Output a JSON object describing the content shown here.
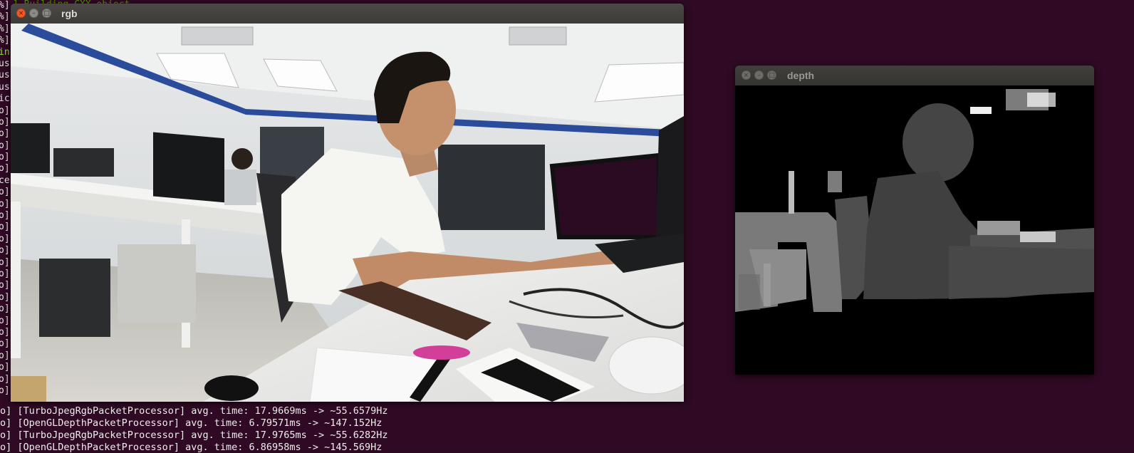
{
  "terminal": {
    "top_line": "] Building CXX object ...",
    "left_gutter": [
      "%]",
      "%]",
      "%]",
      "%]",
      "in",
      "us",
      "us",
      "us",
      "ic",
      "o]",
      "o]",
      "o]",
      "o]",
      "o]",
      "o]",
      "ce",
      "o]",
      "o]",
      "o]",
      "o]",
      "o]",
      "o]",
      "o]",
      "o]",
      "o]",
      "o]",
      "o]",
      "o]",
      "o]",
      "o]",
      "o]",
      "o]",
      "o]",
      "o]"
    ],
    "log_lines": [
      "o] [TurboJpegRgbPacketProcessor] avg. time: 17.9669ms -> ~55.6579Hz",
      "o] [OpenGLDepthPacketProcessor] avg. time: 6.79571ms -> ~147.152Hz",
      "o] [TurboJpegRgbPacketProcessor] avg. time: 17.9765ms -> ~55.6282Hz",
      "o] [OpenGLDepthPacketProcessor] avg. time: 6.86958ms -> ~145.569Hz"
    ]
  },
  "windows": {
    "rgb": {
      "title": "rgb",
      "close_glyph": "×",
      "min_glyph": "–",
      "max_glyph": "□"
    },
    "depth": {
      "title": "depth",
      "close_glyph": "×",
      "min_glyph": "–",
      "max_glyph": "□"
    }
  },
  "colors": {
    "terminal_bg": "#300a24",
    "terminal_text": "#eeeeec",
    "close_button": "#ef5b2e",
    "titlebar": "#3c3b37"
  }
}
